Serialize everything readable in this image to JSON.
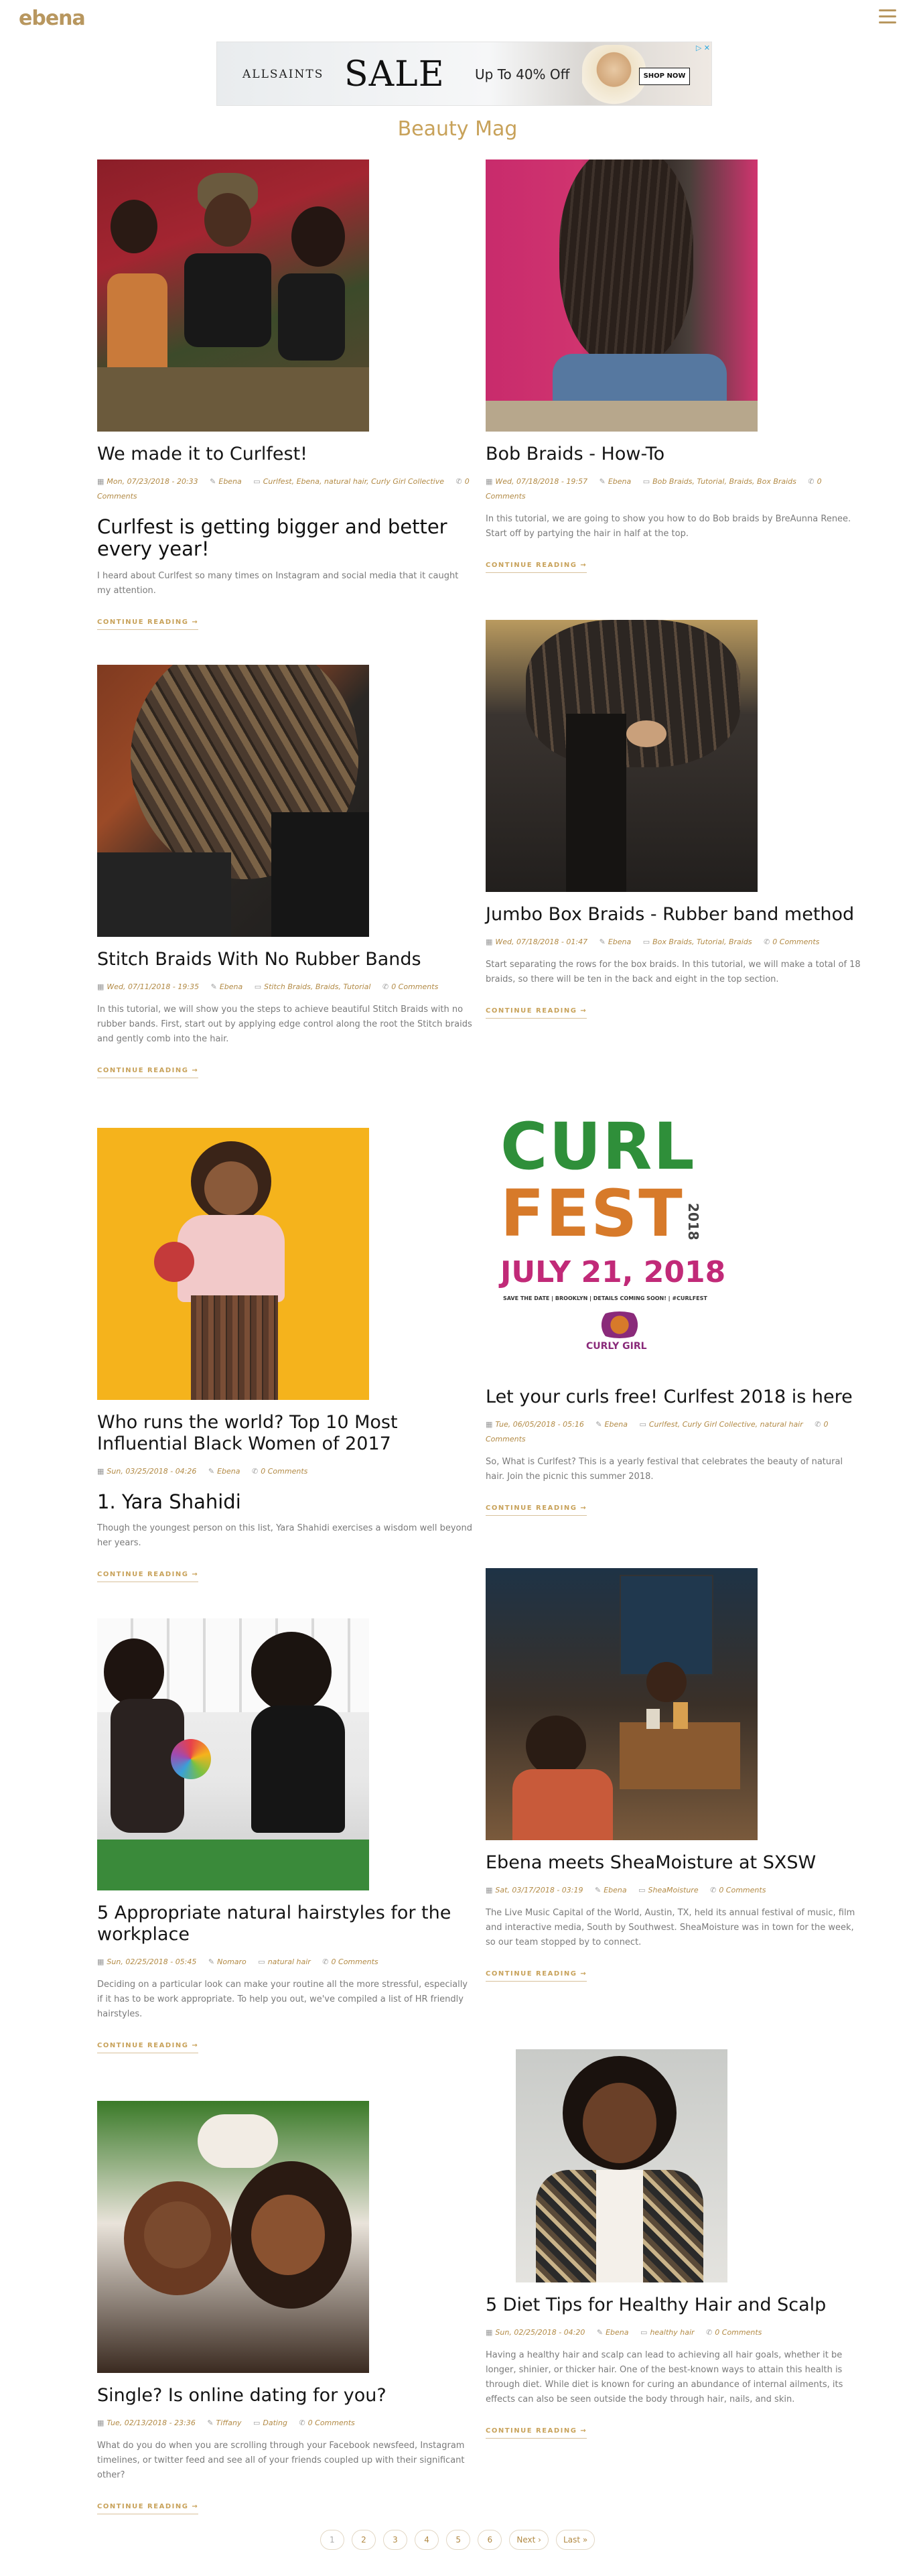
{
  "header": {
    "logo": "ebena",
    "menu_icon": "hamburger-menu-icon"
  },
  "ad": {
    "brand": "ALLSAINTS",
    "headline": "SALE",
    "offer": "Up To 40% Off",
    "cta": "SHOP NOW",
    "badge": "▷ ✕"
  },
  "page_title": "Beauty Mag",
  "icons": {
    "date": "calendar-icon",
    "author": "pencil-icon",
    "category": "folder-icon",
    "comments": "comment-icon"
  },
  "posts": [
    {
      "title": "We made it to Curlfest!",
      "date": "Mon, 07/23/2018 - 20:33",
      "author": "Ebena",
      "categories": "Curlfest, Ebena, natural hair, Curly Girl Collective",
      "comments": "0 Comments",
      "subhead": "Curlfest is getting bigger and better every year!",
      "excerpt": "I heard about Curlfest so many times on Instagram and social media that it caught my attention.",
      "more": "CONTINUE READING →"
    },
    {
      "title": "Bob Braids - How-To",
      "date": "Wed, 07/18/2018 - 19:57",
      "author": "Ebena",
      "categories": "Bob Braids, Tutorial, Braids, Box Braids",
      "comments": "0 Comments",
      "excerpt": "In this tutorial, we are going to show you how to do Bob braids by BreAunna Renee. Start off by partying the hair in half at the top.",
      "more": "CONTINUE READING →"
    },
    {
      "title": "Stitch Braids With No Rubber Bands",
      "date": "Wed, 07/11/2018 - 19:35",
      "author": "Ebena",
      "categories": "Stitch Braids, Braids, Tutorial",
      "comments": "0 Comments",
      "excerpt": "In this tutorial, we will show you the steps to achieve beautiful Stitch Braids with no rubber bands. First, start out by applying edge control along the root the Stitch braids and gently comb into the hair.",
      "more": "CONTINUE READING →"
    },
    {
      "title": "Jumbo Box Braids - Rubber band method",
      "date": "Wed, 07/18/2018 - 01:47",
      "author": "Ebena",
      "categories": "Box Braids, Tutorial, Braids",
      "comments": "0 Comments",
      "excerpt": "Start separating the rows for the box braids. In this tutorial, we will make a total of 18 braids, so there will be ten in the back and eight in the top section.",
      "more": "CONTINUE READING →"
    },
    {
      "title": "Who runs the world? Top 10 Most Influential Black Women of 2017",
      "date": "Sun, 03/25/2018 - 04:26",
      "author": "Ebena",
      "categories": "",
      "comments": "0 Comments",
      "subhead": "1. Yara Shahidi",
      "excerpt": "Though the youngest person on this list, Yara Shahidi exercises a wisdom well beyond her years.",
      "more": "CONTINUE READING →"
    },
    {
      "title": "Let your curls free! Curlfest 2018 is here",
      "date": "Tue, 06/05/2018 - 05:16",
      "author": "Ebena",
      "categories": "Curlfest, Curly Girl Collective, natural hair",
      "comments": "0 Comments",
      "excerpt": "So, What is Curlfest? This is a yearly festival that celebrates the beauty of natural hair. Join the picnic this summer 2018.",
      "more": "CONTINUE READING →"
    },
    {
      "title": "5 Appropriate natural hairstyles for the workplace",
      "date": "Sun, 02/25/2018 - 05:45",
      "author": "Nomaro",
      "categories": "natural hair",
      "comments": "0 Comments",
      "excerpt": "Deciding on a particular look can make your routine all the more stressful, especially if it has to be work appropriate. To help you out, we've compiled a list of HR friendly hairstyles.",
      "more": "CONTINUE READING →"
    },
    {
      "title": "Ebena meets SheaMoisture at SXSW",
      "date": "Sat, 03/17/2018 - 03:19",
      "author": "Ebena",
      "categories": "SheaMoisture",
      "comments": "0 Comments",
      "excerpt": "The Live Music Capital of the World, Austin, TX, held its annual festival of music, film and interactive media, South by Southwest. SheaMoisture was in town for the week, so our team stopped by to connect.",
      "more": "CONTINUE READING →"
    },
    {
      "title": "Single? Is online dating for you?",
      "date": "Tue, 02/13/2018 - 23:36",
      "author": "Tiffany",
      "categories": "Dating",
      "comments": "0 Comments",
      "excerpt": "What do you do when you are scrolling through your Facebook newsfeed, Instagram timelines, or twitter feed and see all of your friends coupled up with their significant other?",
      "more": "CONTINUE READING →"
    },
    {
      "title": "5 Diet Tips for Healthy Hair and Scalp",
      "date": "Sun, 02/25/2018 - 04:20",
      "author": "Ebena",
      "categories": "healthy hair",
      "comments": "0 Comments",
      "excerpt": "Having a healthy hair and scalp can lead to achieving all hair goals, whether it be longer, shinier, or thicker hair. One of the best-known ways to attain this health is through diet. While diet is known for curing an abundance of internal ailments, its effects can also be seen outside the body through hair, nails, and skin.",
      "more": "CONTINUE READING →"
    }
  ],
  "curlfest_image": {
    "line1": "CURL",
    "line2": "FEST",
    "year_vertical": "2018",
    "date": "JULY 21, 2018",
    "tagline": "SAVE THE DATE | BROOKLYN | DETAILS COMING SOON! | #CURLFEST",
    "sponsor": "CURLY GIRL"
  },
  "pager": {
    "pages": [
      "1",
      "2",
      "3",
      "4",
      "5",
      "6"
    ],
    "next": "Next ›",
    "last": "Last »"
  }
}
